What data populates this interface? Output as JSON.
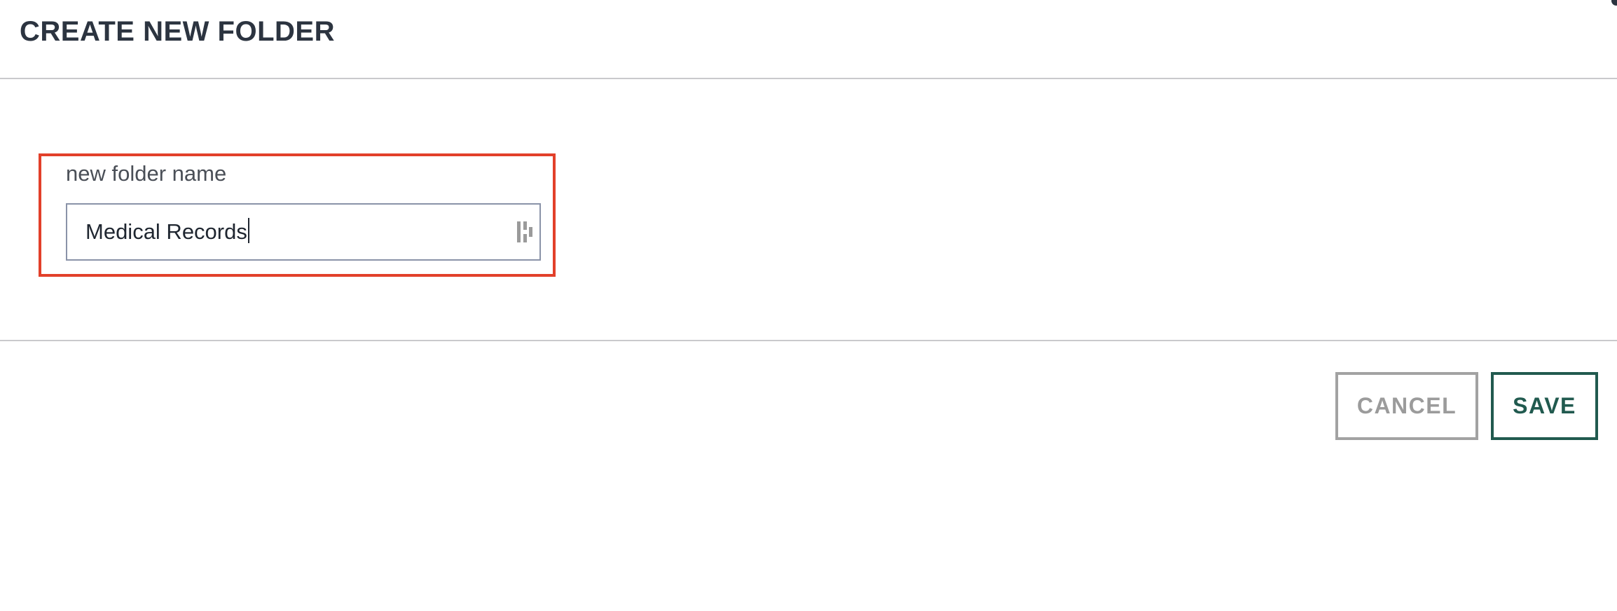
{
  "dialog": {
    "title": "CREATE NEW FOLDER"
  },
  "form": {
    "folder_name_label": "new folder name",
    "folder_name_value": "Medical Records",
    "input_icon": "password-manager-icon",
    "highlight_color": "#e2402a"
  },
  "footer": {
    "cancel_label": "CANCEL",
    "save_label": "SAVE",
    "save_color": "#215a4f",
    "cancel_color": "#9b9b9b"
  }
}
